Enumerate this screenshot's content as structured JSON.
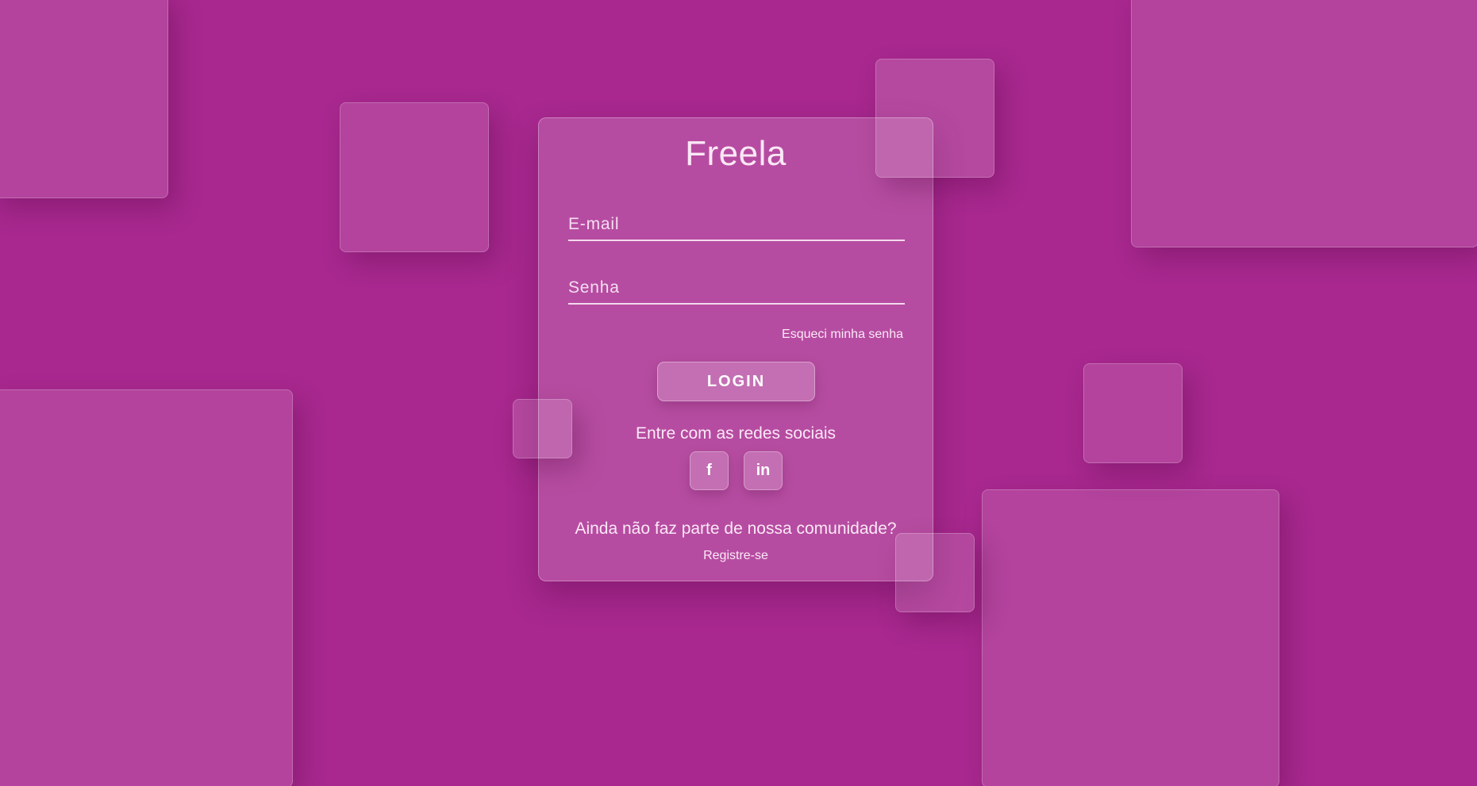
{
  "app": {
    "title": "Freela"
  },
  "login_form": {
    "email_placeholder": "E-mail",
    "email_value": "",
    "password_placeholder": "Senha",
    "password_value": "",
    "forgot_password_label": "Esqueci minha senha",
    "login_button_label": "LOGIN",
    "social_prompt": "Entre com as redes sociais",
    "social_buttons": [
      {
        "icon": "facebook-icon",
        "glyph": "f"
      },
      {
        "icon": "linkedin-icon",
        "glyph": "in"
      }
    ],
    "community_prompt": "Ainda não faz parte de nossa comunidade?",
    "register_label": "Registre-se"
  },
  "theme": {
    "background_color": "#a8288f",
    "text_color": "#ffffff",
    "glass_tint": "rgba(255,255,255,0.17)"
  }
}
